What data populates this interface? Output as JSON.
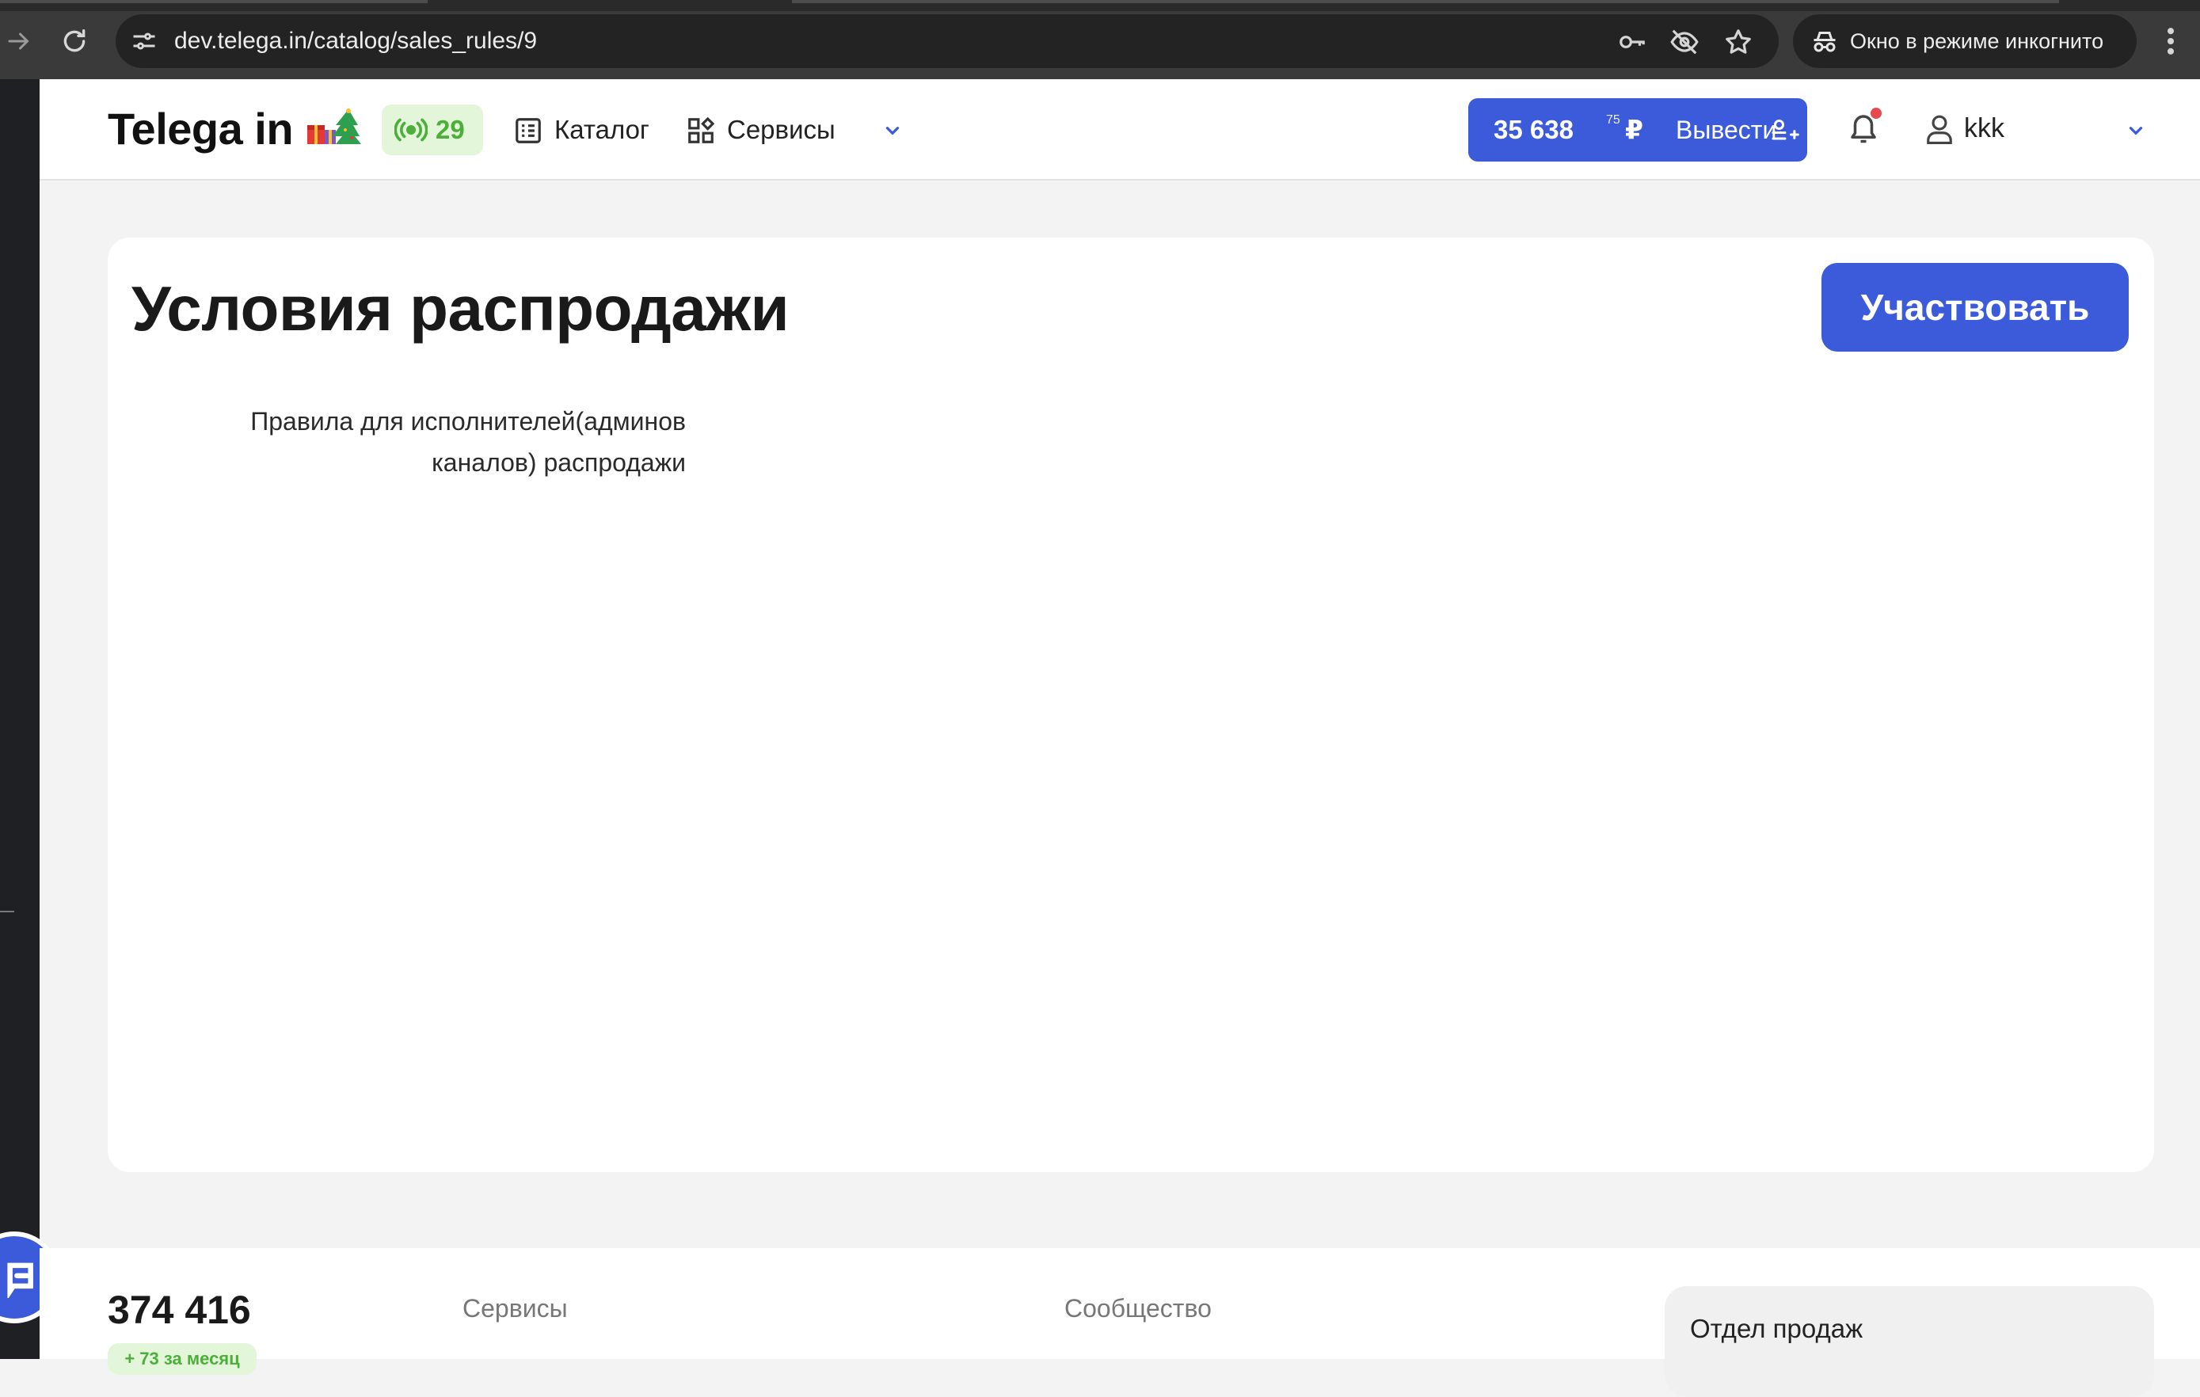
{
  "browser": {
    "url": "dev.telega.in/catalog/sales_rules/9",
    "incognito_label": "Окно в режиме инкогнито"
  },
  "header": {
    "logo": "Telega in",
    "live_count": "29",
    "nav": {
      "catalog": "Каталог",
      "services": "Сервисы"
    },
    "balance": {
      "integer": "35 638",
      "fraction": "75",
      "currency": "₽",
      "withdraw_label": "Вывести"
    },
    "user": {
      "name": "kkk"
    }
  },
  "main": {
    "title": "Условия распродажи",
    "participate_label": "Участвовать",
    "rules_text": "Правила для исполнителей(админов каналов) распродажи"
  },
  "footer": {
    "count": "374 416",
    "growth": "+ 73 за месяц",
    "col_services": "Сервисы",
    "col_community": "Сообщество",
    "sales_title": "Отдел продаж"
  },
  "colors": {
    "accent": "#3b5bdb",
    "live_green": "#4caf3a",
    "live_bg": "#e3f6da",
    "notification": "#e5484d"
  },
  "icons": {
    "site_info": "tune-icon",
    "password": "key-icon",
    "hidden": "eye-off-icon",
    "bookmark": "star-icon",
    "incognito": "incognito-icon",
    "menu": "kebab-menu-icon",
    "live": "broadcast-icon",
    "catalog": "list-icon",
    "services": "grid-icon",
    "withdraw": "wallet-plus-icon",
    "bell": "bell-icon",
    "user": "user-icon",
    "chevron": "chevron-down-icon",
    "chat": "chat-icon"
  }
}
